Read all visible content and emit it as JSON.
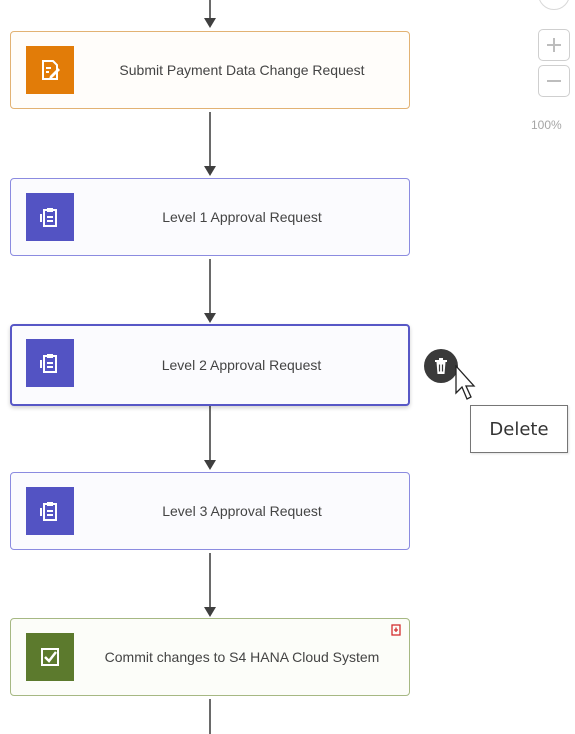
{
  "workflow": {
    "steps": [
      {
        "label": "Submit Payment Data Change Request",
        "type": "form",
        "icon": "form-edit-icon",
        "color": "#e27c08"
      },
      {
        "label": "Level 1 Approval Request",
        "type": "approval",
        "icon": "approval-form-icon",
        "color": "#5353c3"
      },
      {
        "label": "Level 2 Approval Request",
        "type": "approval",
        "icon": "approval-form-icon",
        "color": "#5353c3",
        "selected": true
      },
      {
        "label": "Level 3 Approval Request",
        "type": "approval",
        "icon": "approval-form-icon",
        "color": "#5353c3"
      },
      {
        "label": "Commit changes to S4 HANA Cloud System",
        "type": "automation",
        "icon": "checkbox-icon",
        "color": "#5c7a2d",
        "status_icon": "warning-icon"
      }
    ]
  },
  "zoom": {
    "zoom_in_icon": "plus-icon",
    "zoom_out_icon": "minus-icon",
    "level": "100%"
  },
  "delete_action": {
    "icon": "trash-icon",
    "tooltip": "Delete"
  },
  "colors": {
    "form_node_border": "#e2b273",
    "approval_node_border": "#8b8be0",
    "automation_node_border": "#a6b883",
    "connector": "#6a6a6a",
    "warning": "#d32f2f"
  }
}
